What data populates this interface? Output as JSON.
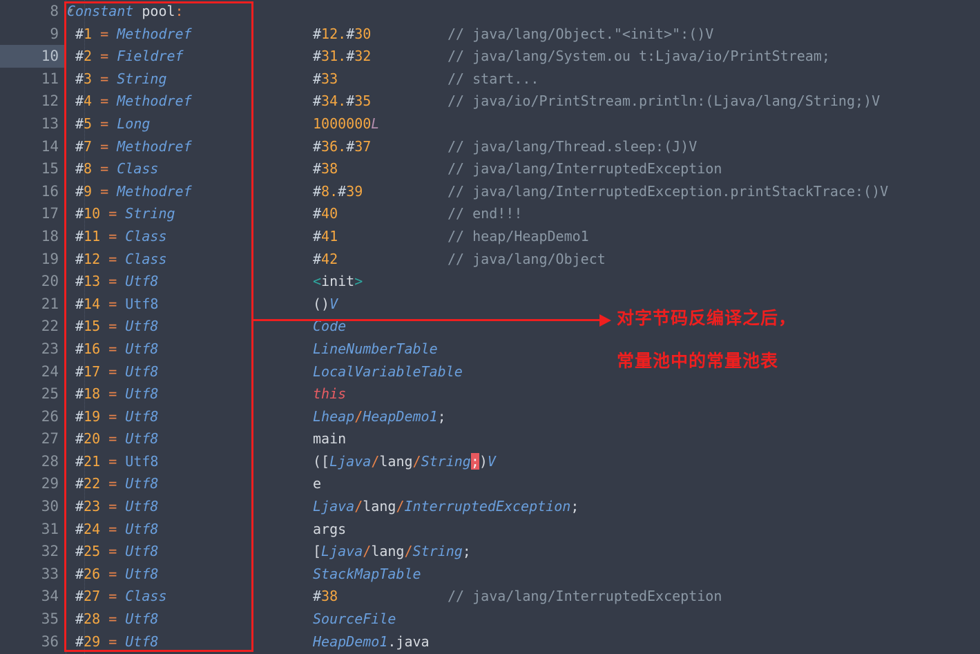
{
  "editor": {
    "background_color": "#353b48",
    "active_line_number": 10,
    "fold_caret_line": 8,
    "line_numbers": [
      8,
      9,
      10,
      11,
      12,
      13,
      14,
      15,
      16,
      17,
      18,
      19,
      20,
      21,
      22,
      23,
      24,
      25,
      26,
      27,
      28,
      29,
      30,
      31,
      32,
      33,
      34,
      35,
      36
    ]
  },
  "annotation": {
    "color": "#ef1f1f",
    "line1": "对字节码反编译之后，",
    "line2": "常量池中的常量池表"
  },
  "lines": [
    {
      "n": 8,
      "header": "Constant pool:"
    },
    {
      "n": 9,
      "pool": "#1 = Methodref",
      "ref": "1",
      "type": "Methodref",
      "italic": true,
      "value": "#12.#30",
      "comment": "// java/lang/Object.\"<init>\":()V"
    },
    {
      "n": 10,
      "pool": "#2 = Fieldref",
      "ref": "2",
      "type": "Fieldref",
      "italic": true,
      "value": "#31.#32",
      "comment": "// java/lang/System.ou t:Ljava/io/PrintStream;"
    },
    {
      "n": 11,
      "pool": "#3 = String",
      "ref": "3",
      "type": "String",
      "italic": true,
      "value": "#33",
      "comment": "// start..."
    },
    {
      "n": 12,
      "pool": "#4 = Methodref",
      "ref": "4",
      "type": "Methodref",
      "italic": true,
      "value": "#34.#35",
      "comment": "// java/io/PrintStream.println:(Ljava/lang/String;)V"
    },
    {
      "n": 13,
      "pool": "#5 = Long",
      "ref": "5",
      "type": "Long",
      "italic": true,
      "value": "1000000L",
      "comment": ""
    },
    {
      "n": 14,
      "pool": "#7 = Methodref",
      "ref": "7",
      "type": "Methodref",
      "italic": true,
      "value": "#36.#37",
      "comment": "// java/lang/Thread.sleep:(J)V"
    },
    {
      "n": 15,
      "pool": "#8 = Class",
      "ref": "8",
      "type": "Class",
      "italic": true,
      "value": "#38",
      "comment": "// java/lang/InterruptedException"
    },
    {
      "n": 16,
      "pool": "#9 = Methodref",
      "ref": "9",
      "type": "Methodref",
      "italic": true,
      "value": "#8.#39",
      "comment": "// java/lang/InterruptedException.printStackTrace:()V"
    },
    {
      "n": 17,
      "pool": "#10 = String",
      "ref": "10",
      "type": "String",
      "italic": true,
      "value": "#40",
      "comment": "// end!!!"
    },
    {
      "n": 18,
      "pool": "#11 = Class",
      "ref": "11",
      "type": "Class",
      "italic": true,
      "value": "#41",
      "comment": "// heap/HeapDemo1"
    },
    {
      "n": 19,
      "pool": "#12 = Class",
      "ref": "12",
      "type": "Class",
      "italic": true,
      "value": "#42",
      "comment": "// java/lang/Object"
    },
    {
      "n": 20,
      "pool": "#13 = Utf8",
      "ref": "13",
      "type": "Utf8",
      "italic": true,
      "value": "<init>",
      "comment": ""
    },
    {
      "n": 21,
      "pool": "#14 = Utf8",
      "ref": "14",
      "type": "Utf8",
      "italic": false,
      "value": "()V",
      "comment": ""
    },
    {
      "n": 22,
      "pool": "#15 = Utf8",
      "ref": "15",
      "type": "Utf8",
      "italic": true,
      "value": "Code",
      "comment": ""
    },
    {
      "n": 23,
      "pool": "#16 = Utf8",
      "ref": "16",
      "type": "Utf8",
      "italic": true,
      "value": "LineNumberTable",
      "comment": ""
    },
    {
      "n": 24,
      "pool": "#17 = Utf8",
      "ref": "17",
      "type": "Utf8",
      "italic": true,
      "value": "LocalVariableTable",
      "comment": ""
    },
    {
      "n": 25,
      "pool": "#18 = Utf8",
      "ref": "18",
      "type": "Utf8",
      "italic": true,
      "value": "this",
      "comment": ""
    },
    {
      "n": 26,
      "pool": "#19 = Utf8",
      "ref": "19",
      "type": "Utf8",
      "italic": true,
      "value": "Lheap/HeapDemo1;",
      "comment": ""
    },
    {
      "n": 27,
      "pool": "#20 = Utf8",
      "ref": "20",
      "type": "Utf8",
      "italic": true,
      "value": "main",
      "comment": ""
    },
    {
      "n": 28,
      "pool": "#21 = Utf8",
      "ref": "21",
      "type": "Utf8",
      "italic": false,
      "value": "([Ljava/lang/String;)V",
      "comment": ""
    },
    {
      "n": 29,
      "pool": "#22 = Utf8",
      "ref": "22",
      "type": "Utf8",
      "italic": true,
      "value": "e",
      "comment": ""
    },
    {
      "n": 30,
      "pool": "#23 = Utf8",
      "ref": "23",
      "type": "Utf8",
      "italic": true,
      "value": "Ljava/lang/InterruptedException;",
      "comment": ""
    },
    {
      "n": 31,
      "pool": "#24 = Utf8",
      "ref": "24",
      "type": "Utf8",
      "italic": true,
      "value": "args",
      "comment": ""
    },
    {
      "n": 32,
      "pool": "#25 = Utf8",
      "ref": "25",
      "type": "Utf8",
      "italic": true,
      "value": "[Ljava/lang/String;",
      "comment": ""
    },
    {
      "n": 33,
      "pool": "#26 = Utf8",
      "ref": "26",
      "type": "Utf8",
      "italic": true,
      "value": "StackMapTable",
      "comment": ""
    },
    {
      "n": 34,
      "pool": "#27 = Class",
      "ref": "27",
      "type": "Class",
      "italic": true,
      "value": "#38",
      "comment": "// java/lang/InterruptedException"
    },
    {
      "n": 35,
      "pool": "#28 = Utf8",
      "ref": "28",
      "type": "Utf8",
      "italic": true,
      "value": "SourceFile",
      "comment": ""
    },
    {
      "n": 36,
      "pool": "#29 = Utf8",
      "ref": "29",
      "type": "Utf8",
      "italic": true,
      "value": "HeapDemo1.java",
      "comment": ""
    }
  ],
  "header": {
    "keyword": "Constant",
    "word": "pool",
    "colon": ":"
  },
  "colors": {
    "background": "#353b48",
    "keyword_blue": "#6a9fdd",
    "number_orange": "#f5a742",
    "punct_orange": "#e8834a",
    "comment_gray": "#8b98a5",
    "plain_text": "#d6dae0",
    "annotation_red": "#ef1f1f",
    "active_line": "#4b5668",
    "match_highlight": "#e8595f"
  }
}
